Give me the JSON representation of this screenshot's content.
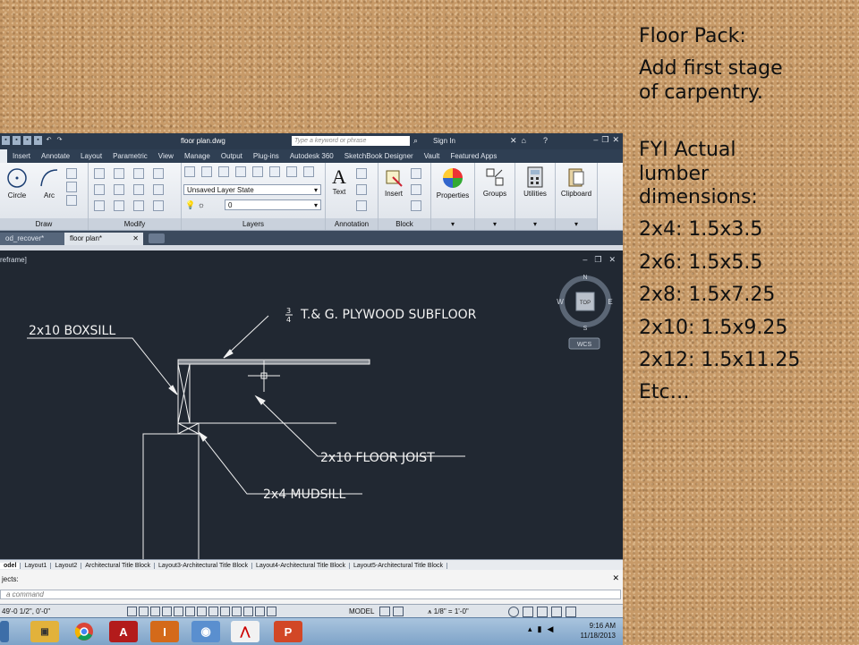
{
  "slide": {
    "lines": [
      "Floor Pack:",
      "Add first stage",
      "of carpentry.",
      "FYI Actual",
      "lumber",
      "dimensions:",
      "2x4: 1.5x3.5",
      "2x6: 1.5x5.5",
      "2x8: 1.5x7.25",
      "2x10: 1.5x9.25",
      "2x12: 1.5x11.25",
      "Etc…"
    ]
  },
  "window": {
    "doc_title": "floor plan.dwg",
    "search_placeholder": "Type a keyword or phrase",
    "sign_in": "Sign In"
  },
  "ribbon_tabs": [
    "Insert",
    "Annotate",
    "Layout",
    "Parametric",
    "View",
    "Manage",
    "Output",
    "Plug-ins",
    "Autodesk 360",
    "SketchBook Designer",
    "Vault",
    "Featured Apps"
  ],
  "ribbon": {
    "circle": "Circle",
    "arc": "Arc",
    "layer_state": "Unsaved Layer State",
    "layer_current": "0",
    "text": "Text",
    "insert": "Insert",
    "properties": "Properties",
    "groups": "Groups",
    "utilities": "Utilities",
    "clipboard": "Clipboard",
    "panel_draw": "Draw",
    "panel_modify": "Modify",
    "panel_layers": "Layers",
    "panel_annotation": "Annotation",
    "panel_block": "Block"
  },
  "file_tabs": {
    "tab1": "od_recover*",
    "tab2": "floor plan*"
  },
  "viewport": {
    "label": "reframe]",
    "compass": {
      "top": "TOP",
      "n": "N",
      "s": "S",
      "e": "E",
      "w": "W",
      "wcs": "WCS"
    }
  },
  "drawing": {
    "label_subfloor_fraction_top": "3",
    "label_subfloor_fraction_bottom": "4",
    "label_subfloor": "T.& G. PLYWOOD SUBFLOOR",
    "label_boxsill": "2x10 BOXSILL",
    "label_joist": "2x10 FLOOR JOIST",
    "label_mudsill": "2x4 MUDSILL"
  },
  "layout_tabs": [
    "odel",
    "Layout1",
    "Layout2",
    "Architectural Title Block",
    "Layout3-Architectural Title Block",
    "Layout4-Architectural Title Block",
    "Layout5-Architectural Title Block"
  ],
  "command": {
    "history": "jects:",
    "placeholder": "a command"
  },
  "status": {
    "coords": "49'-0 1/2\", 0'-0\"",
    "model": "MODEL",
    "scale": "1/8\" = 1'-0\""
  },
  "taskbar": {
    "time": "9:16 AM",
    "date": "11/18/2013"
  },
  "colors": {
    "viewport_bg": "#212832",
    "drawing_lines": "#f2f2f2",
    "ribbon_dark": "#2f3f53",
    "cork": "#c79a68"
  }
}
